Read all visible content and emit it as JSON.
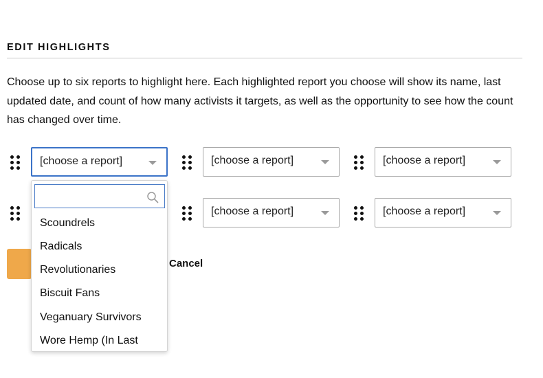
{
  "section": {
    "title": "EDIT HIGHLIGHTS",
    "description": "Choose up to six reports to highlight here. Each highlighted report you choose will show its name, last updated date, and count of how many activists it targets, as well as the opportunity to see how the count has changed over time."
  },
  "selects": [
    {
      "value": "[choose a report]"
    },
    {
      "value": "[choose a report]"
    },
    {
      "value": "[choose a report]"
    },
    {
      "value": "[choose a report]"
    },
    {
      "value": "[choose a report]"
    }
  ],
  "dropdown": {
    "search_value": "",
    "options": [
      "Scoundrels",
      "Radicals",
      "Revolutionaries",
      "Biscuit Fans",
      "Veganuary Survivors",
      "Wore Hemp (In Last"
    ]
  },
  "actions": {
    "save_label": "",
    "cancel_label": "Cancel"
  },
  "colors": {
    "accent_orange": "#efa84a",
    "focus_blue": "#3b73c8",
    "border_gray": "#a8a8a8"
  },
  "icons": [
    "drag-handle-icon",
    "caret-down-icon",
    "search-icon"
  ]
}
